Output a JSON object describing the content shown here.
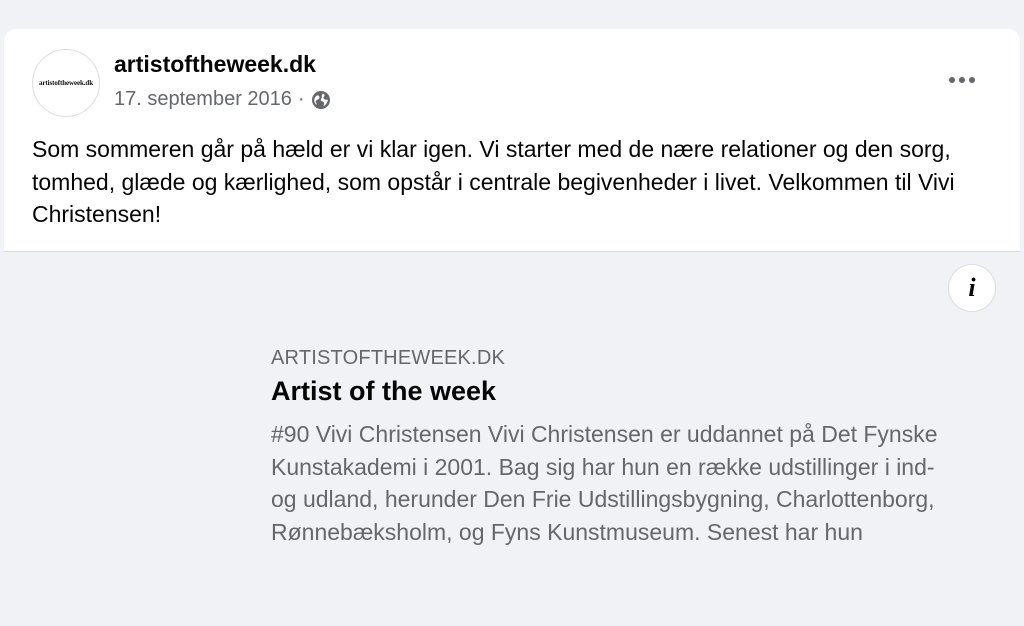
{
  "post": {
    "page_name": "artistoftheweek.dk",
    "avatar_text": "artistoftheweek.dk",
    "date": "17. september 2016",
    "separator": "·",
    "audience_icon": "globe-icon",
    "more_icon": "more-options-icon",
    "text": "Som sommeren går på hæld er vi klar igen. Vi starter med de nære relationer og den sorg, tomhed, glæde og kærlighed, som opstår i centrale begivenheder i livet. Velkommen til Vivi Christensen!"
  },
  "link_preview": {
    "info_icon": "info-icon",
    "info_glyph": "i",
    "domain": "ARTISTOFTHEWEEK.DK",
    "title": "Artist of the week",
    "description": "#90 Vivi Christensen Vivi Christensen er uddannet på Det Fynske Kunstakademi i 2001. Bag sig har hun en række udstillinger i ind- og udland, herunder Den Frie Udstillingsbygning, Charlottenborg, Rønnebæksholm, og Fyns Kunstmuseum. Senest har hun"
  },
  "colors": {
    "page_background": "#f0f2f5",
    "card_background": "#ffffff",
    "primary_text": "#050505",
    "secondary_text": "#65676b"
  }
}
